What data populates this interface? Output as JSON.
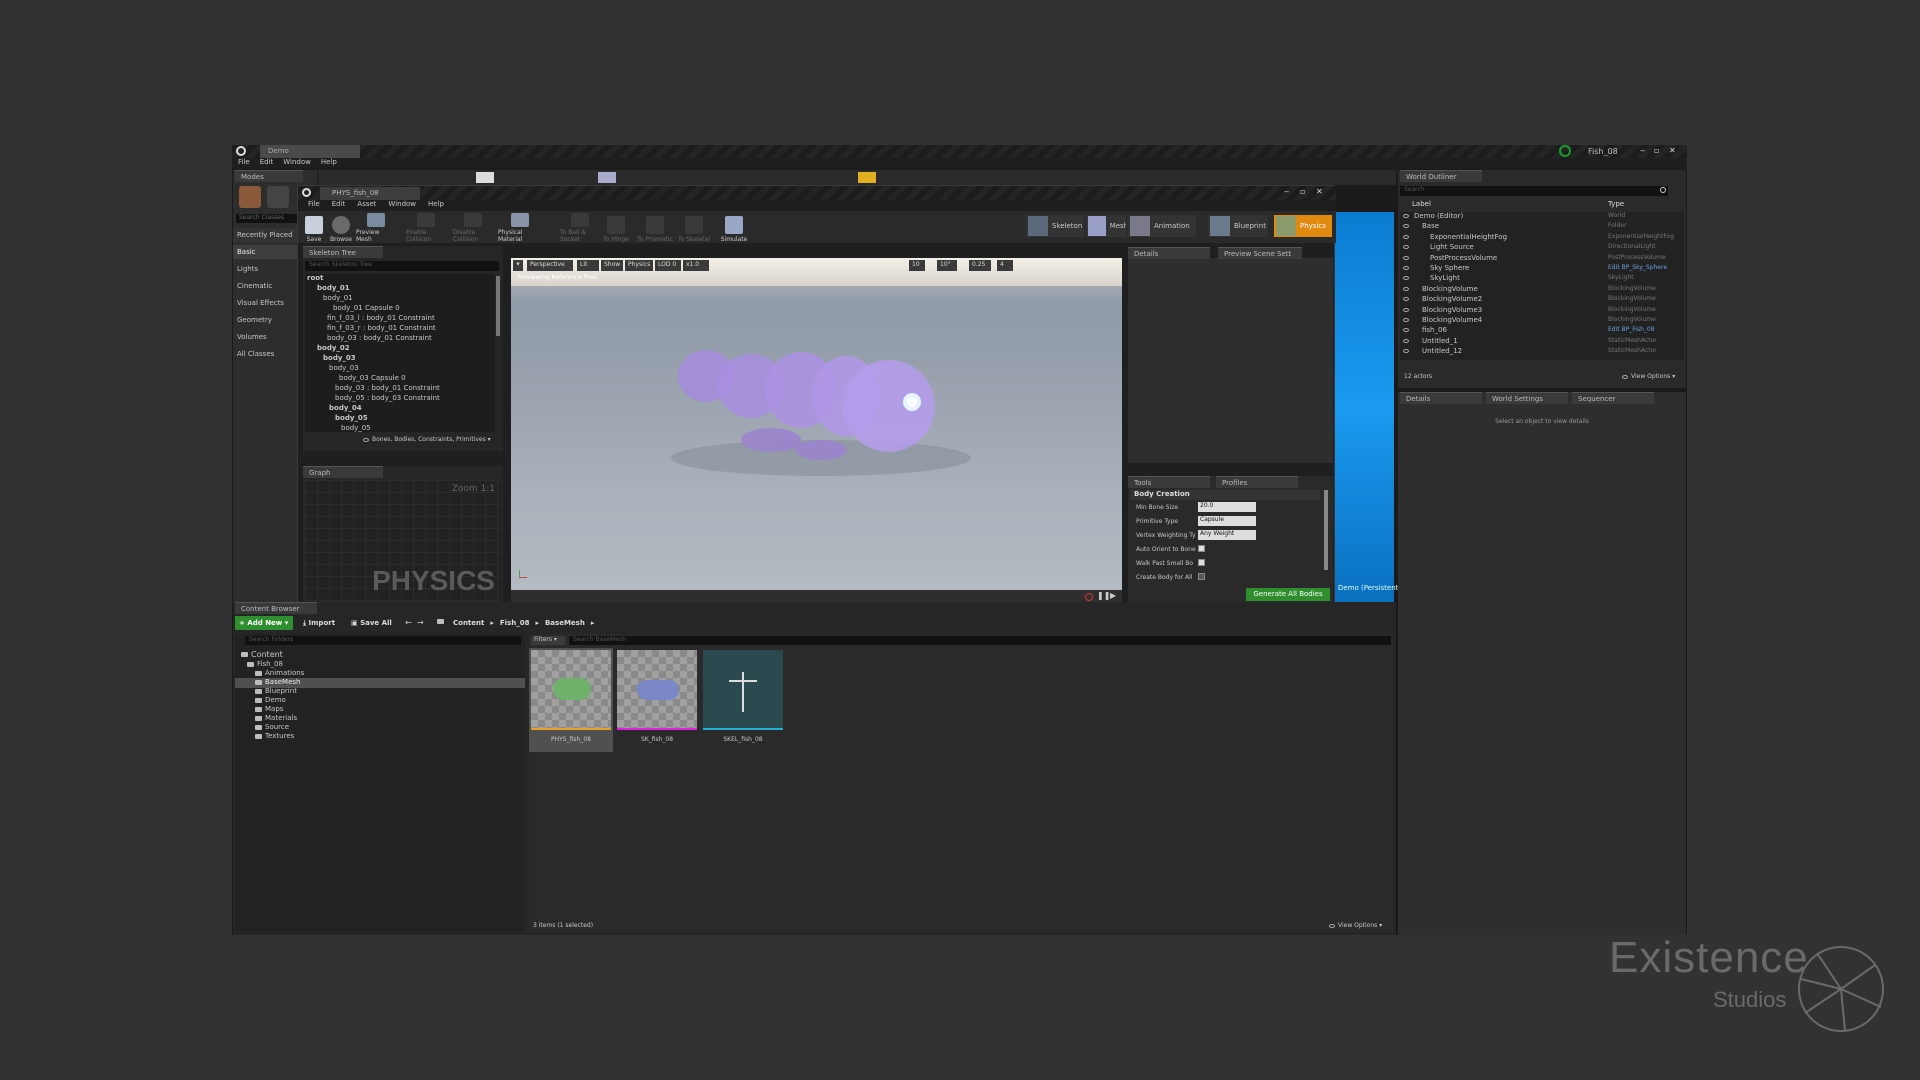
{
  "editor": {
    "tab": "Demo",
    "menu": [
      "File",
      "Edit",
      "Window",
      "Help"
    ],
    "project": "Fish_08",
    "modes_tab": "Modes"
  },
  "modes": {
    "search_placeholder": "Search Classes",
    "categories": [
      "Recently Placed",
      "Basic",
      "Lights",
      "Cinematic",
      "Visual Effects",
      "Geometry",
      "Volumes",
      "All Classes"
    ]
  },
  "phat": {
    "tab": "PHYS_fish_08",
    "menu": [
      "File",
      "Edit",
      "Asset",
      "Window",
      "Help"
    ],
    "toolbar": [
      "Save",
      "Browse",
      "Preview Mesh",
      "Enable Collision",
      "Disable Collision",
      "Physical Material",
      "To Ball & Socket",
      "To Hinge",
      "To Prismatic",
      "To Skeletal",
      "Simulate"
    ],
    "modes": [
      "Skeleton",
      "Mesh",
      "Animation",
      "Blueprint",
      "Physics"
    ],
    "skeleton_tab": "Skeleton Tree",
    "skeleton_search": "Search Skeleton Tree",
    "tree": [
      "root",
      "body_01",
      "body_01",
      "body_01 Capsule 0",
      "fin_f_03_l : body_01 Constraint",
      "fin_f_03_r : body_01 Constraint",
      "body_03 : body_01 Constraint",
      "body_02",
      "body_03",
      "body_03",
      "body_03 Capsule 0",
      "body_03 : body_01 Constraint",
      "body_05 : body_03 Constraint",
      "body_04",
      "body_05",
      "body_05"
    ],
    "tree_filter": "Bones, Bodies, Constraints, Primitives",
    "graph_tab": "Graph",
    "graph_zoom": "Zoom 1:1",
    "graph_watermark": "PHYSICS",
    "viewport": {
      "buttons": [
        "Perspective",
        "Lit",
        "Show",
        "Physics",
        "LOD 0",
        "x1.0"
      ],
      "grid": "10",
      "angle": "10°",
      "scale": "0.25",
      "cam": "4",
      "overlay": "Previewing Reference Pose"
    },
    "details_tab": "Details",
    "preview_tab": "Preview Scene Sett",
    "tools_tab": "Tools",
    "profiles_tab": "Profiles",
    "body_creation": "Body Creation",
    "props": [
      {
        "label": "Min Bone Size",
        "value": "20.0"
      },
      {
        "label": "Primitive Type",
        "value": "Capsule"
      },
      {
        "label": "Vertex Weighting Ty",
        "value": "Any Weight"
      }
    ],
    "checks": [
      "Auto Orient to Bone",
      "Walk Past Small Bo",
      "Create Body for All"
    ],
    "generate": "Generate All Bodies",
    "persist": "Demo (Persistent)"
  },
  "outliner": {
    "tab": "World Outliner",
    "search": "Search",
    "col_label": "Label",
    "col_type": "Type",
    "items": [
      {
        "label": "Demo (Editor)",
        "type": "World"
      },
      {
        "label": "Base",
        "type": "Folder"
      },
      {
        "label": "ExponentialHeightFog",
        "type": "ExponentialHeightFog"
      },
      {
        "label": "Light Source",
        "type": "DirectionalLight"
      },
      {
        "label": "PostProcessVolume",
        "type": "PostProcessVolume"
      },
      {
        "label": "Sky Sphere",
        "type": "Edit BP_Sky_Sphere"
      },
      {
        "label": "SkyLight",
        "type": "SkyLight"
      },
      {
        "label": "BlockingVolume",
        "type": "BlockingVolume"
      },
      {
        "label": "BlockingVolume2",
        "type": "BlockingVolume"
      },
      {
        "label": "BlockingVolume3",
        "type": "BlockingVolume"
      },
      {
        "label": "BlockingVolume4",
        "type": "BlockingVolume"
      },
      {
        "label": "fish_06",
        "type": "Edit BP_Fish_08"
      },
      {
        "label": "Untitled_1",
        "type": "StaticMeshActor"
      },
      {
        "label": "Untitled_12",
        "type": "StaticMeshActor"
      }
    ],
    "count": "12 actors",
    "view_options": "View Options"
  },
  "details": {
    "tabs": [
      "Details",
      "World Settings",
      "Sequencer"
    ],
    "empty": "Select an object to view details"
  },
  "content": {
    "tab": "Content Browser",
    "add_new": "Add New",
    "import": "Import",
    "save_all": "Save All",
    "path": [
      "Content",
      "Fish_08",
      "BaseMesh"
    ],
    "folder_search": "Search Folders",
    "filters": "Filters",
    "asset_search": "Search BaseMesh",
    "folders": [
      "Content",
      "Fish_08",
      "Animations",
      "BaseMesh",
      "Blueprint",
      "Demo",
      "Maps",
      "Materials",
      "Source",
      "Textures"
    ],
    "assets": [
      {
        "name": "PHYS_fish_08",
        "color": "#e8a020"
      },
      {
        "name": "SK_fish_08",
        "color": "#e020e0"
      },
      {
        "name": "SKEL_fish_08",
        "color": "#20b0d0"
      }
    ],
    "status": "3 items (1 selected)",
    "view_options": "View Options"
  },
  "brand": {
    "name": "Existence",
    "sub": "Studios"
  }
}
